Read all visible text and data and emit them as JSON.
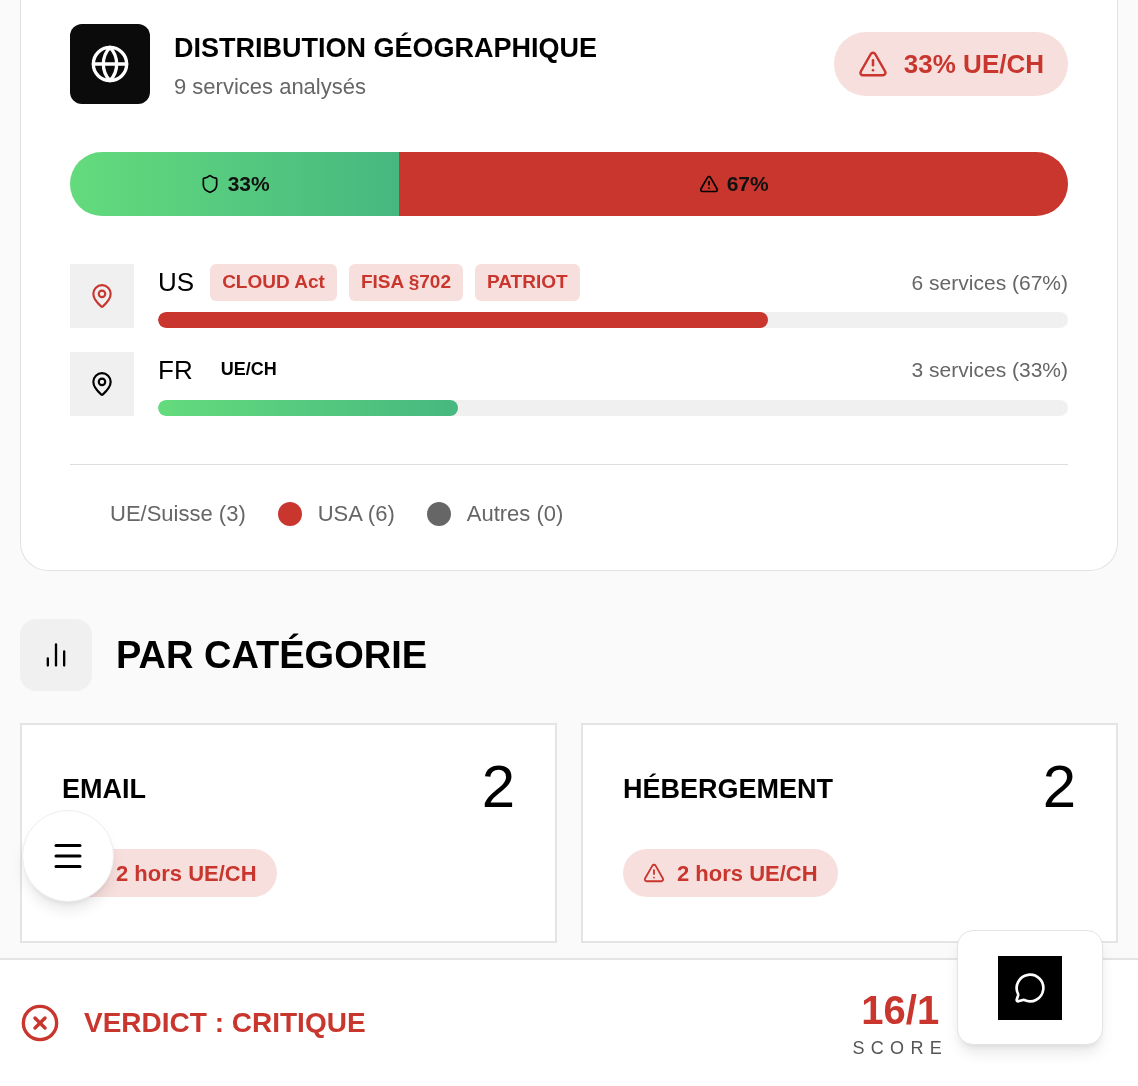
{
  "distribution": {
    "title": "DISTRIBUTION GÉOGRAPHIQUE",
    "subtitle": "9 services analysés",
    "badge": "33% UE/CH",
    "split": [
      {
        "kind": "safe",
        "label": "33%",
        "level": 0.33
      },
      {
        "kind": "risk",
        "label": "67%",
        "level": 0.67
      }
    ],
    "countries": [
      {
        "kind": "risk",
        "code": "US",
        "tags": [
          "CLOUD Act",
          "FISA §702",
          "PATRIOT"
        ],
        "reading": "6 services (67%)",
        "level": 0.67
      },
      {
        "kind": "safe",
        "code": "FR",
        "tags": [
          "UE/CH"
        ],
        "reading": "3 services (33%)",
        "level": 0.33
      }
    ],
    "legend": [
      {
        "label": "UE/Suisse (3)"
      },
      {
        "label": "USA (6)",
        "color": "#c9362e"
      },
      {
        "label": "Autres (0)",
        "color": "#666666"
      }
    ]
  },
  "categories": {
    "title": "PAR CATÉGORIE",
    "items": [
      {
        "name": "EMAIL",
        "count": "2",
        "badge": "2 hors UE/CH"
      },
      {
        "name": "HÉBERGEMENT",
        "count": "2",
        "badge": "2 hors UE/CH"
      }
    ]
  },
  "verdict": {
    "label": "VERDICT : CRITIQUE",
    "score": "16/1",
    "score_label": "SCORE"
  }
}
